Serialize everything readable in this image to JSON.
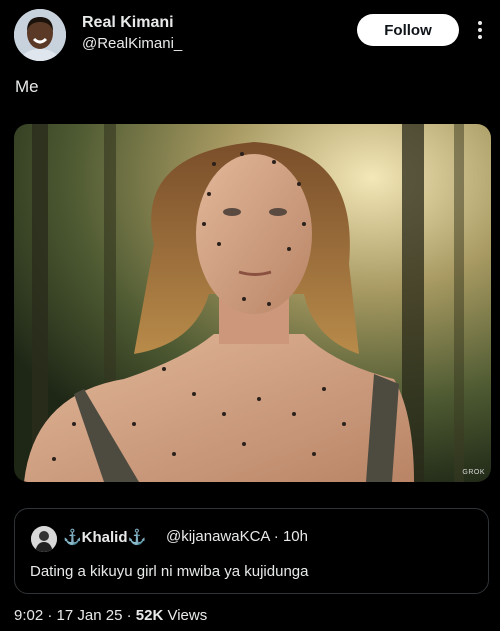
{
  "author": {
    "display_name": "Real Kimani",
    "handle": "@RealKimani_",
    "follow_label": "Follow"
  },
  "post": {
    "text": "Me",
    "media_watermark": "GROK"
  },
  "quoted_post": {
    "display_name": "⚓Khalid⚓",
    "handle": "@kijanawaKCA",
    "separator": "·",
    "time_ago": "10h",
    "text": "Dating a kikuyu girl ni mwiba ya kujidunga"
  },
  "meta": {
    "time": "9:02",
    "date": "17 Jan 25",
    "views_count": "52K",
    "views_label": "Views",
    "separator": "·"
  },
  "colors": {
    "background": "#000000",
    "text": "#e7e9ea",
    "follow_bg": "#ffffff",
    "border": "#2f3336"
  },
  "icons": [
    "more-vertical-icon",
    "grok-logo-icon"
  ]
}
